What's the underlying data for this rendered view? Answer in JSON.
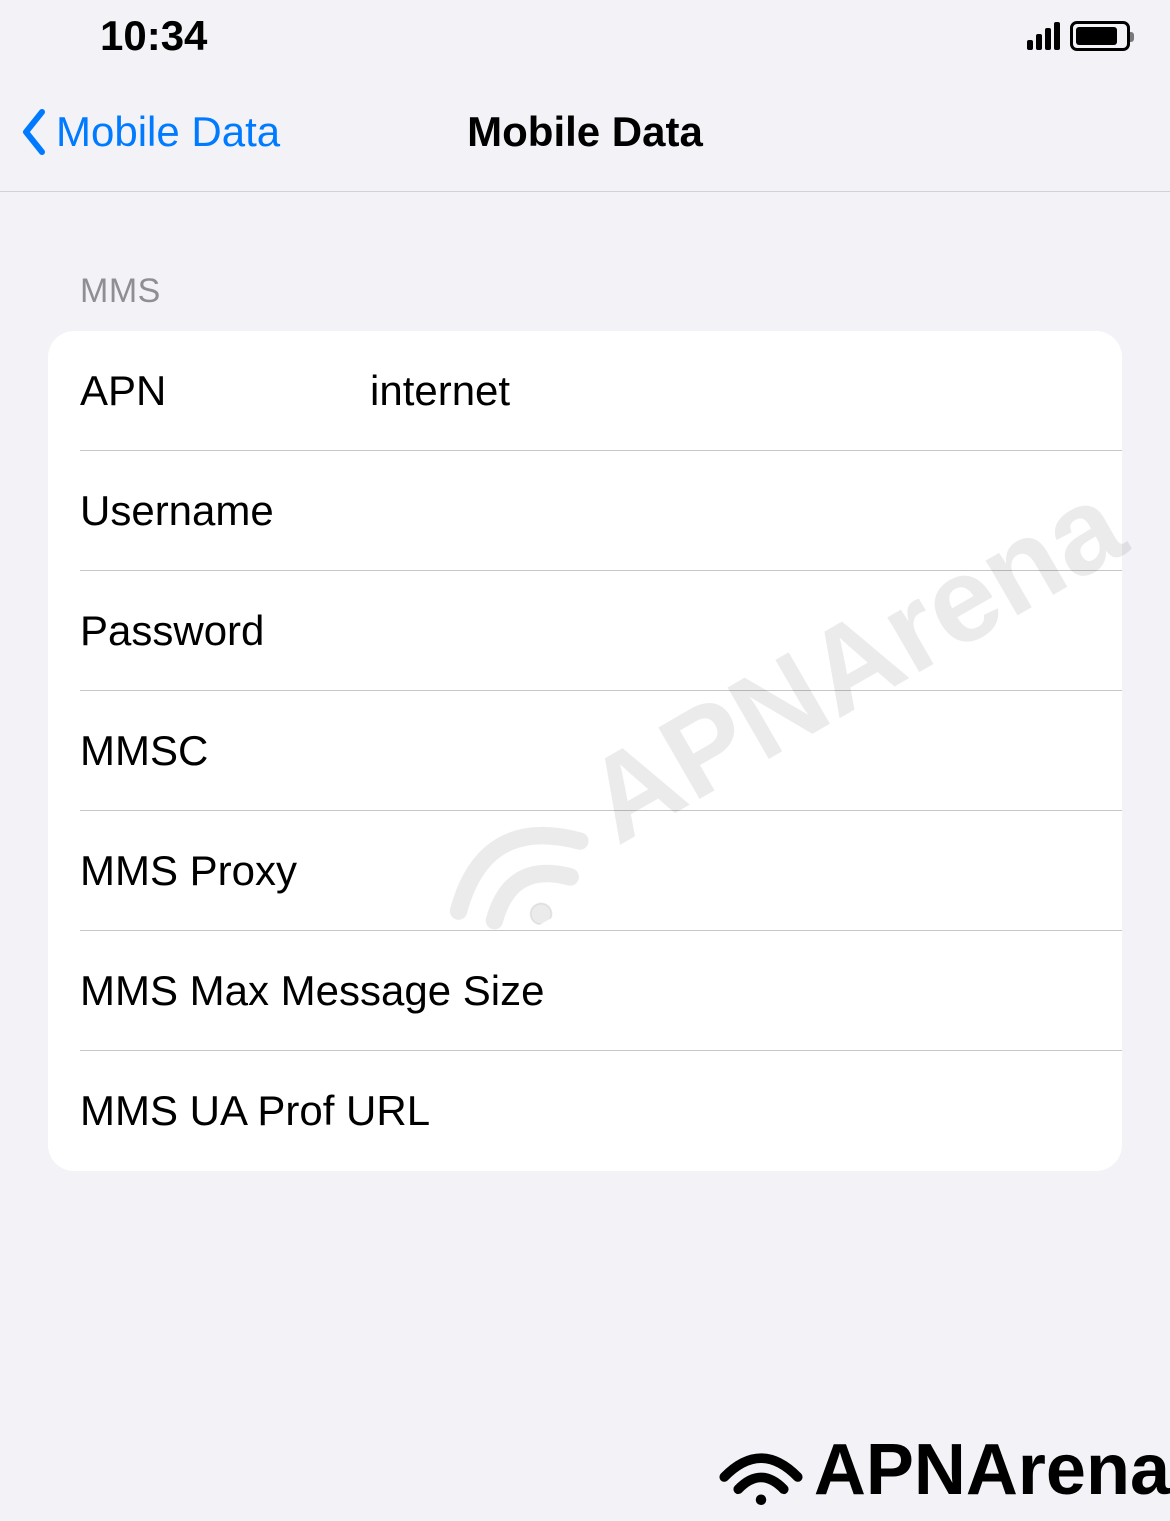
{
  "statusBar": {
    "time": "10:34"
  },
  "nav": {
    "backLabel": "Mobile Data",
    "title": "Mobile Data"
  },
  "section": {
    "header": "MMS",
    "rows": [
      {
        "label": "APN",
        "value": "internet"
      },
      {
        "label": "Username",
        "value": ""
      },
      {
        "label": "Password",
        "value": ""
      },
      {
        "label": "MMSC",
        "value": ""
      },
      {
        "label": "MMS Proxy",
        "value": ""
      },
      {
        "label": "MMS Max Message Size",
        "value": ""
      },
      {
        "label": "MMS UA Prof URL",
        "value": ""
      }
    ]
  },
  "watermark": {
    "text": "APNArena"
  },
  "footer": {
    "brand": "APNArena"
  }
}
